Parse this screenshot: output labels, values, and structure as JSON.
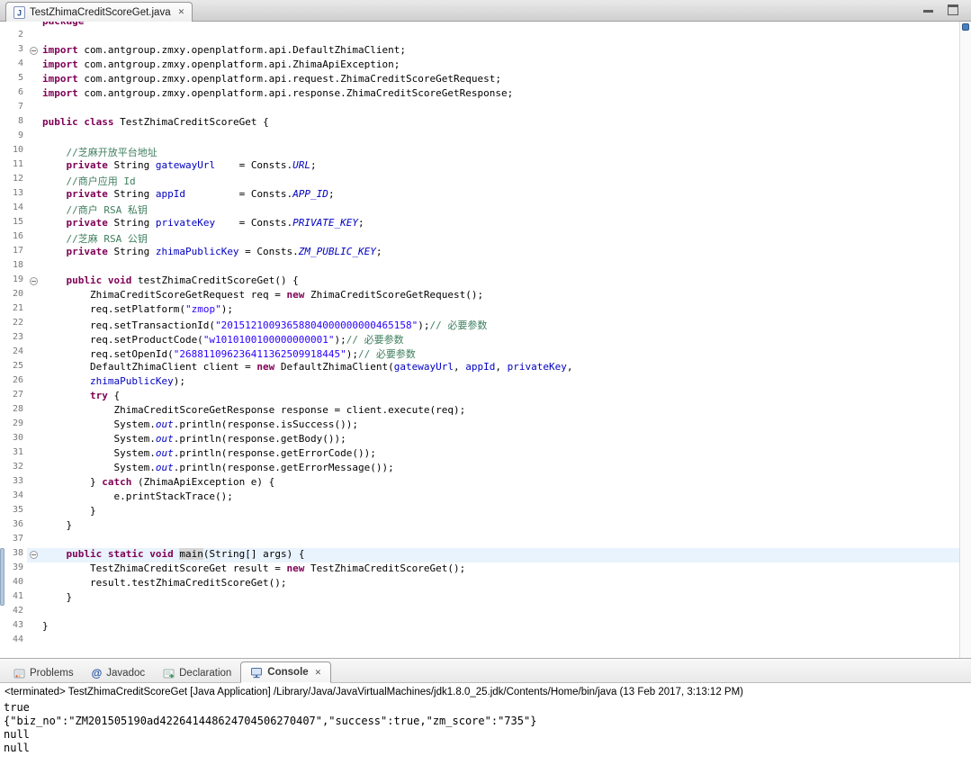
{
  "editor": {
    "tab_title": "TestZhimaCreditScoreGet.java",
    "lines": [
      {
        "n": "",
        "seg": [
          [
            "k",
            "package"
          ]
        ]
      },
      {
        "n": 2,
        "seg": []
      },
      {
        "n": 3,
        "fold": true,
        "seg": [
          [
            "k",
            "import"
          ],
          [
            "p",
            " com.antgroup.zmxy.openplatform.api.DefaultZhimaClient;"
          ]
        ]
      },
      {
        "n": 4,
        "seg": [
          [
            "k",
            "import"
          ],
          [
            "p",
            " com.antgroup.zmxy.openplatform.api.ZhimaApiException;"
          ]
        ]
      },
      {
        "n": 5,
        "seg": [
          [
            "k",
            "import"
          ],
          [
            "p",
            " com.antgroup.zmxy.openplatform.api.request.ZhimaCreditScoreGetRequest;"
          ]
        ]
      },
      {
        "n": 6,
        "seg": [
          [
            "k",
            "import"
          ],
          [
            "p",
            " com.antgroup.zmxy.openplatform.api.response.ZhimaCreditScoreGetResponse;"
          ]
        ]
      },
      {
        "n": 7,
        "seg": []
      },
      {
        "n": 8,
        "seg": [
          [
            "k",
            "public"
          ],
          [
            "p",
            " "
          ],
          [
            "k",
            "class"
          ],
          [
            "p",
            " TestZhimaCreditScoreGet {"
          ]
        ]
      },
      {
        "n": 9,
        "seg": []
      },
      {
        "n": 10,
        "seg": [
          [
            "p",
            "    "
          ],
          [
            "c",
            "//芝麻开放平台地址"
          ]
        ]
      },
      {
        "n": 11,
        "seg": [
          [
            "p",
            "    "
          ],
          [
            "k",
            "private"
          ],
          [
            "p",
            " String "
          ],
          [
            "f",
            "gatewayUrl"
          ],
          [
            "p",
            "    = Consts."
          ],
          [
            "sf",
            "URL"
          ],
          [
            "p",
            ";"
          ]
        ]
      },
      {
        "n": 12,
        "seg": [
          [
            "p",
            "    "
          ],
          [
            "c",
            "//商户应用 Id"
          ]
        ]
      },
      {
        "n": 13,
        "seg": [
          [
            "p",
            "    "
          ],
          [
            "k",
            "private"
          ],
          [
            "p",
            " String "
          ],
          [
            "f",
            "appId"
          ],
          [
            "p",
            "         = Consts."
          ],
          [
            "sf",
            "APP_ID"
          ],
          [
            "p",
            ";"
          ]
        ]
      },
      {
        "n": 14,
        "seg": [
          [
            "p",
            "    "
          ],
          [
            "c",
            "//商户 RSA 私钥"
          ]
        ]
      },
      {
        "n": 15,
        "seg": [
          [
            "p",
            "    "
          ],
          [
            "k",
            "private"
          ],
          [
            "p",
            " String "
          ],
          [
            "f",
            "privateKey"
          ],
          [
            "p",
            "    = Consts."
          ],
          [
            "sf",
            "PRIVATE_KEY"
          ],
          [
            "p",
            ";"
          ]
        ]
      },
      {
        "n": 16,
        "seg": [
          [
            "p",
            "    "
          ],
          [
            "c",
            "//芝麻 RSA 公钥"
          ]
        ]
      },
      {
        "n": 17,
        "seg": [
          [
            "p",
            "    "
          ],
          [
            "k",
            "private"
          ],
          [
            "p",
            " String "
          ],
          [
            "f",
            "zhimaPublicKey"
          ],
          [
            "p",
            " = Consts."
          ],
          [
            "sf",
            "ZM_PUBLIC_KEY"
          ],
          [
            "p",
            ";"
          ]
        ]
      },
      {
        "n": 18,
        "seg": []
      },
      {
        "n": 19,
        "fold": true,
        "seg": [
          [
            "p",
            "    "
          ],
          [
            "k",
            "public"
          ],
          [
            "p",
            " "
          ],
          [
            "k",
            "void"
          ],
          [
            "p",
            " testZhimaCreditScoreGet() {"
          ]
        ]
      },
      {
        "n": 20,
        "seg": [
          [
            "p",
            "        ZhimaCreditScoreGetRequest req = "
          ],
          [
            "k",
            "new"
          ],
          [
            "p",
            " ZhimaCreditScoreGetRequest();"
          ]
        ]
      },
      {
        "n": 21,
        "seg": [
          [
            "p",
            "        req.setPlatform("
          ],
          [
            "s",
            "\"zmop\""
          ],
          [
            "p",
            ");"
          ]
        ]
      },
      {
        "n": 22,
        "seg": [
          [
            "p",
            "        req.setTransactionId("
          ],
          [
            "s",
            "\"20151210093658804000000000465158\""
          ],
          [
            "p",
            ");"
          ],
          [
            "c",
            "// 必要参数"
          ]
        ]
      },
      {
        "n": 23,
        "seg": [
          [
            "p",
            "        req.setProductCode("
          ],
          [
            "s",
            "\"w1010100100000000001\""
          ],
          [
            "p",
            ");"
          ],
          [
            "c",
            "// 必要参数"
          ]
        ]
      },
      {
        "n": 24,
        "seg": [
          [
            "p",
            "        req.setOpenId("
          ],
          [
            "s",
            "\"268811096236411362509918445\""
          ],
          [
            "p",
            ");"
          ],
          [
            "c",
            "// 必要参数"
          ]
        ]
      },
      {
        "n": 25,
        "seg": [
          [
            "p",
            "        DefaultZhimaClient client = "
          ],
          [
            "k",
            "new"
          ],
          [
            "p",
            " DefaultZhimaClient("
          ],
          [
            "f",
            "gatewayUrl"
          ],
          [
            "p",
            ", "
          ],
          [
            "f",
            "appId"
          ],
          [
            "p",
            ", "
          ],
          [
            "f",
            "privateKey"
          ],
          [
            "p",
            ","
          ]
        ]
      },
      {
        "n": 26,
        "seg": [
          [
            "p",
            "        "
          ],
          [
            "f",
            "zhimaPublicKey"
          ],
          [
            "p",
            ");"
          ]
        ]
      },
      {
        "n": 27,
        "seg": [
          [
            "p",
            "        "
          ],
          [
            "k",
            "try"
          ],
          [
            "p",
            " {"
          ]
        ]
      },
      {
        "n": 28,
        "seg": [
          [
            "p",
            "            ZhimaCreditScoreGetResponse response = client.execute(req);"
          ]
        ]
      },
      {
        "n": 29,
        "seg": [
          [
            "p",
            "            System."
          ],
          [
            "sf",
            "out"
          ],
          [
            "p",
            ".println(response.isSuccess());"
          ]
        ]
      },
      {
        "n": 30,
        "seg": [
          [
            "p",
            "            System."
          ],
          [
            "sf",
            "out"
          ],
          [
            "p",
            ".println(response.getBody());"
          ]
        ]
      },
      {
        "n": 31,
        "seg": [
          [
            "p",
            "            System."
          ],
          [
            "sf",
            "out"
          ],
          [
            "p",
            ".println(response.getErrorCode());"
          ]
        ]
      },
      {
        "n": 32,
        "seg": [
          [
            "p",
            "            System."
          ],
          [
            "sf",
            "out"
          ],
          [
            "p",
            ".println(response.getErrorMessage());"
          ]
        ]
      },
      {
        "n": 33,
        "seg": [
          [
            "p",
            "        } "
          ],
          [
            "k",
            "catch"
          ],
          [
            "p",
            " (ZhimaApiException e) {"
          ]
        ]
      },
      {
        "n": 34,
        "seg": [
          [
            "p",
            "            e.printStackTrace();"
          ]
        ]
      },
      {
        "n": 35,
        "seg": [
          [
            "p",
            "        }"
          ]
        ]
      },
      {
        "n": 36,
        "seg": [
          [
            "p",
            "    }"
          ]
        ]
      },
      {
        "n": 37,
        "seg": []
      },
      {
        "n": 38,
        "fold": true,
        "cur": true,
        "seg": [
          [
            "p",
            "    "
          ],
          [
            "k",
            "public"
          ],
          [
            "p",
            " "
          ],
          [
            "k",
            "static"
          ],
          [
            "p",
            " "
          ],
          [
            "k",
            "void"
          ],
          [
            "p",
            " "
          ],
          [
            "occ",
            "main"
          ],
          [
            "p",
            "(String[] args) {"
          ]
        ]
      },
      {
        "n": 39,
        "seg": [
          [
            "p",
            "        TestZhimaCreditScoreGet result = "
          ],
          [
            "k",
            "new"
          ],
          [
            "p",
            " TestZhimaCreditScoreGet();"
          ]
        ]
      },
      {
        "n": 40,
        "seg": [
          [
            "p",
            "        result.testZhimaCreditScoreGet();"
          ]
        ]
      },
      {
        "n": 41,
        "seg": [
          [
            "p",
            "    }"
          ]
        ]
      },
      {
        "n": 42,
        "seg": []
      },
      {
        "n": 43,
        "seg": [
          [
            "p",
            "}"
          ]
        ]
      },
      {
        "n": 44,
        "seg": []
      }
    ]
  },
  "icons": {
    "close": "✕",
    "javadoc": "@"
  },
  "bottom": {
    "tabs": [
      {
        "label": "Problems"
      },
      {
        "label": "Javadoc"
      },
      {
        "label": "Declaration"
      },
      {
        "label": "Console",
        "active": true
      }
    ]
  },
  "console": {
    "header": "<terminated> TestZhimaCreditScoreGet [Java Application] /Library/Java/JavaVirtualMachines/jdk1.8.0_25.jdk/Contents/Home/bin/java (13 Feb 2017, 3:13:12 PM)",
    "output": [
      "true",
      "{\"biz_no\":\"ZM201505190ad422641448624704506270407\",\"success\":true,\"zm_score\":\"735\"}",
      "null",
      "null"
    ]
  },
  "colors": {
    "keyword": "#7f0055",
    "string": "#2a00ff",
    "comment": "#3f7f5f",
    "field": "#0000c0",
    "current_line_highlight": "#e9f3fd",
    "occurrence_highlight": "#d7d7d7"
  }
}
